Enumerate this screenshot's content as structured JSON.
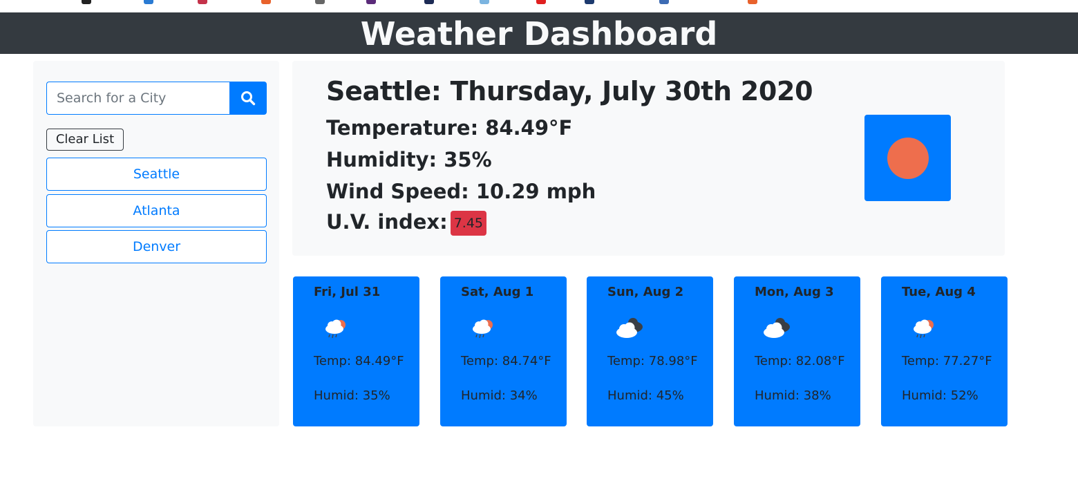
{
  "header": {
    "title": "Weather Dashboard"
  },
  "sidebar": {
    "search_placeholder": "Search for a City",
    "clear_label": "Clear List",
    "cities": [
      "Seattle",
      "Atlanta",
      "Denver"
    ]
  },
  "current": {
    "title": "Seattle: Thursday, July 30th 2020",
    "temperature": "Temperature: 84.49°F",
    "humidity": "Humidity: 35%",
    "wind": "Wind Speed: 10.29 mph",
    "uv_label": "U.V. index:",
    "uv_value": "7.45",
    "icon": "sun-icon"
  },
  "forecast": [
    {
      "date": "Fri, Jul 31",
      "temp": "Temp: 84.49°F",
      "humid": "Humid: 35%",
      "icon": "rain-sun-icon"
    },
    {
      "date": "Sat, Aug 1",
      "temp": "Temp: 84.74°F",
      "humid": "Humid: 34%",
      "icon": "rain-sun-icon"
    },
    {
      "date": "Sun, Aug 2",
      "temp": "Temp: 78.98°F",
      "humid": "Humid: 45%",
      "icon": "cloudy-icon"
    },
    {
      "date": "Mon, Aug 3",
      "temp": "Temp: 82.08°F",
      "humid": "Humid: 38%",
      "icon": "cloudy-icon"
    },
    {
      "date": "Tue, Aug 4",
      "temp": "Temp: 77.27°F",
      "humid": "Humid: 52%",
      "icon": "rain-sun-icon"
    }
  ],
  "colors": {
    "navbar": "#343a40",
    "primary": "#007bff",
    "uv_badge": "#dc3545",
    "sun": "#ee6e4d",
    "panel": "#f8f9fa"
  }
}
